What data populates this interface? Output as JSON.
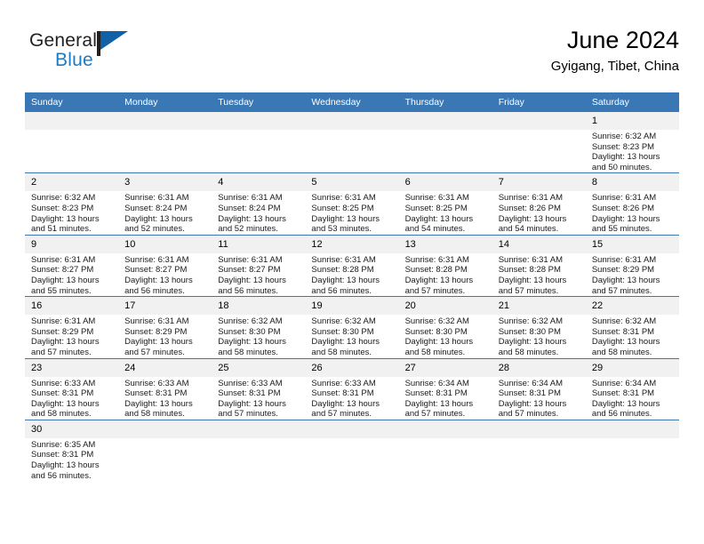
{
  "brand": {
    "name_top": "General",
    "name_bottom": "Blue",
    "accent_color": "#1061a6",
    "text_color": "#231f20"
  },
  "header": {
    "title": "June 2024",
    "subtitle": "Gyigang, Tibet, China"
  },
  "theme": {
    "header_bg": "#3a77b5",
    "header_text": "#ffffff",
    "daynum_bg": "#f1f1f1",
    "cell_bg": "#ffffff",
    "grid_line": "#3a77b5"
  },
  "weekday_headers": [
    "Sunday",
    "Monday",
    "Tuesday",
    "Wednesday",
    "Thursday",
    "Friday",
    "Saturday"
  ],
  "weeks": [
    [
      {
        "day": "",
        "blank": true
      },
      {
        "day": "",
        "blank": true
      },
      {
        "day": "",
        "blank": true
      },
      {
        "day": "",
        "blank": true
      },
      {
        "day": "",
        "blank": true
      },
      {
        "day": "",
        "blank": true
      },
      {
        "day": "1",
        "sunrise": "Sunrise: 6:32 AM",
        "sunset": "Sunset: 8:23 PM",
        "daylight": "Daylight: 13 hours and 50 minutes."
      }
    ],
    [
      {
        "day": "2",
        "sunrise": "Sunrise: 6:32 AM",
        "sunset": "Sunset: 8:23 PM",
        "daylight": "Daylight: 13 hours and 51 minutes."
      },
      {
        "day": "3",
        "sunrise": "Sunrise: 6:31 AM",
        "sunset": "Sunset: 8:24 PM",
        "daylight": "Daylight: 13 hours and 52 minutes."
      },
      {
        "day": "4",
        "sunrise": "Sunrise: 6:31 AM",
        "sunset": "Sunset: 8:24 PM",
        "daylight": "Daylight: 13 hours and 52 minutes."
      },
      {
        "day": "5",
        "sunrise": "Sunrise: 6:31 AM",
        "sunset": "Sunset: 8:25 PM",
        "daylight": "Daylight: 13 hours and 53 minutes."
      },
      {
        "day": "6",
        "sunrise": "Sunrise: 6:31 AM",
        "sunset": "Sunset: 8:25 PM",
        "daylight": "Daylight: 13 hours and 54 minutes."
      },
      {
        "day": "7",
        "sunrise": "Sunrise: 6:31 AM",
        "sunset": "Sunset: 8:26 PM",
        "daylight": "Daylight: 13 hours and 54 minutes."
      },
      {
        "day": "8",
        "sunrise": "Sunrise: 6:31 AM",
        "sunset": "Sunset: 8:26 PM",
        "daylight": "Daylight: 13 hours and 55 minutes."
      }
    ],
    [
      {
        "day": "9",
        "sunrise": "Sunrise: 6:31 AM",
        "sunset": "Sunset: 8:27 PM",
        "daylight": "Daylight: 13 hours and 55 minutes."
      },
      {
        "day": "10",
        "sunrise": "Sunrise: 6:31 AM",
        "sunset": "Sunset: 8:27 PM",
        "daylight": "Daylight: 13 hours and 56 minutes."
      },
      {
        "day": "11",
        "sunrise": "Sunrise: 6:31 AM",
        "sunset": "Sunset: 8:27 PM",
        "daylight": "Daylight: 13 hours and 56 minutes."
      },
      {
        "day": "12",
        "sunrise": "Sunrise: 6:31 AM",
        "sunset": "Sunset: 8:28 PM",
        "daylight": "Daylight: 13 hours and 56 minutes."
      },
      {
        "day": "13",
        "sunrise": "Sunrise: 6:31 AM",
        "sunset": "Sunset: 8:28 PM",
        "daylight": "Daylight: 13 hours and 57 minutes."
      },
      {
        "day": "14",
        "sunrise": "Sunrise: 6:31 AM",
        "sunset": "Sunset: 8:28 PM",
        "daylight": "Daylight: 13 hours and 57 minutes."
      },
      {
        "day": "15",
        "sunrise": "Sunrise: 6:31 AM",
        "sunset": "Sunset: 8:29 PM",
        "daylight": "Daylight: 13 hours and 57 minutes."
      }
    ],
    [
      {
        "day": "16",
        "sunrise": "Sunrise: 6:31 AM",
        "sunset": "Sunset: 8:29 PM",
        "daylight": "Daylight: 13 hours and 57 minutes."
      },
      {
        "day": "17",
        "sunrise": "Sunrise: 6:31 AM",
        "sunset": "Sunset: 8:29 PM",
        "daylight": "Daylight: 13 hours and 57 minutes."
      },
      {
        "day": "18",
        "sunrise": "Sunrise: 6:32 AM",
        "sunset": "Sunset: 8:30 PM",
        "daylight": "Daylight: 13 hours and 58 minutes."
      },
      {
        "day": "19",
        "sunrise": "Sunrise: 6:32 AM",
        "sunset": "Sunset: 8:30 PM",
        "daylight": "Daylight: 13 hours and 58 minutes."
      },
      {
        "day": "20",
        "sunrise": "Sunrise: 6:32 AM",
        "sunset": "Sunset: 8:30 PM",
        "daylight": "Daylight: 13 hours and 58 minutes."
      },
      {
        "day": "21",
        "sunrise": "Sunrise: 6:32 AM",
        "sunset": "Sunset: 8:30 PM",
        "daylight": "Daylight: 13 hours and 58 minutes."
      },
      {
        "day": "22",
        "sunrise": "Sunrise: 6:32 AM",
        "sunset": "Sunset: 8:31 PM",
        "daylight": "Daylight: 13 hours and 58 minutes."
      }
    ],
    [
      {
        "day": "23",
        "sunrise": "Sunrise: 6:33 AM",
        "sunset": "Sunset: 8:31 PM",
        "daylight": "Daylight: 13 hours and 58 minutes."
      },
      {
        "day": "24",
        "sunrise": "Sunrise: 6:33 AM",
        "sunset": "Sunset: 8:31 PM",
        "daylight": "Daylight: 13 hours and 58 minutes."
      },
      {
        "day": "25",
        "sunrise": "Sunrise: 6:33 AM",
        "sunset": "Sunset: 8:31 PM",
        "daylight": "Daylight: 13 hours and 57 minutes."
      },
      {
        "day": "26",
        "sunrise": "Sunrise: 6:33 AM",
        "sunset": "Sunset: 8:31 PM",
        "daylight": "Daylight: 13 hours and 57 minutes."
      },
      {
        "day": "27",
        "sunrise": "Sunrise: 6:34 AM",
        "sunset": "Sunset: 8:31 PM",
        "daylight": "Daylight: 13 hours and 57 minutes."
      },
      {
        "day": "28",
        "sunrise": "Sunrise: 6:34 AM",
        "sunset": "Sunset: 8:31 PM",
        "daylight": "Daylight: 13 hours and 57 minutes."
      },
      {
        "day": "29",
        "sunrise": "Sunrise: 6:34 AM",
        "sunset": "Sunset: 8:31 PM",
        "daylight": "Daylight: 13 hours and 56 minutes."
      }
    ],
    [
      {
        "day": "30",
        "sunrise": "Sunrise: 6:35 AM",
        "sunset": "Sunset: 8:31 PM",
        "daylight": "Daylight: 13 hours and 56 minutes."
      },
      {
        "day": "",
        "empty": true
      },
      {
        "day": "",
        "empty": true
      },
      {
        "day": "",
        "empty": true
      },
      {
        "day": "",
        "empty": true
      },
      {
        "day": "",
        "empty": true
      },
      {
        "day": "",
        "empty": true
      }
    ]
  ]
}
